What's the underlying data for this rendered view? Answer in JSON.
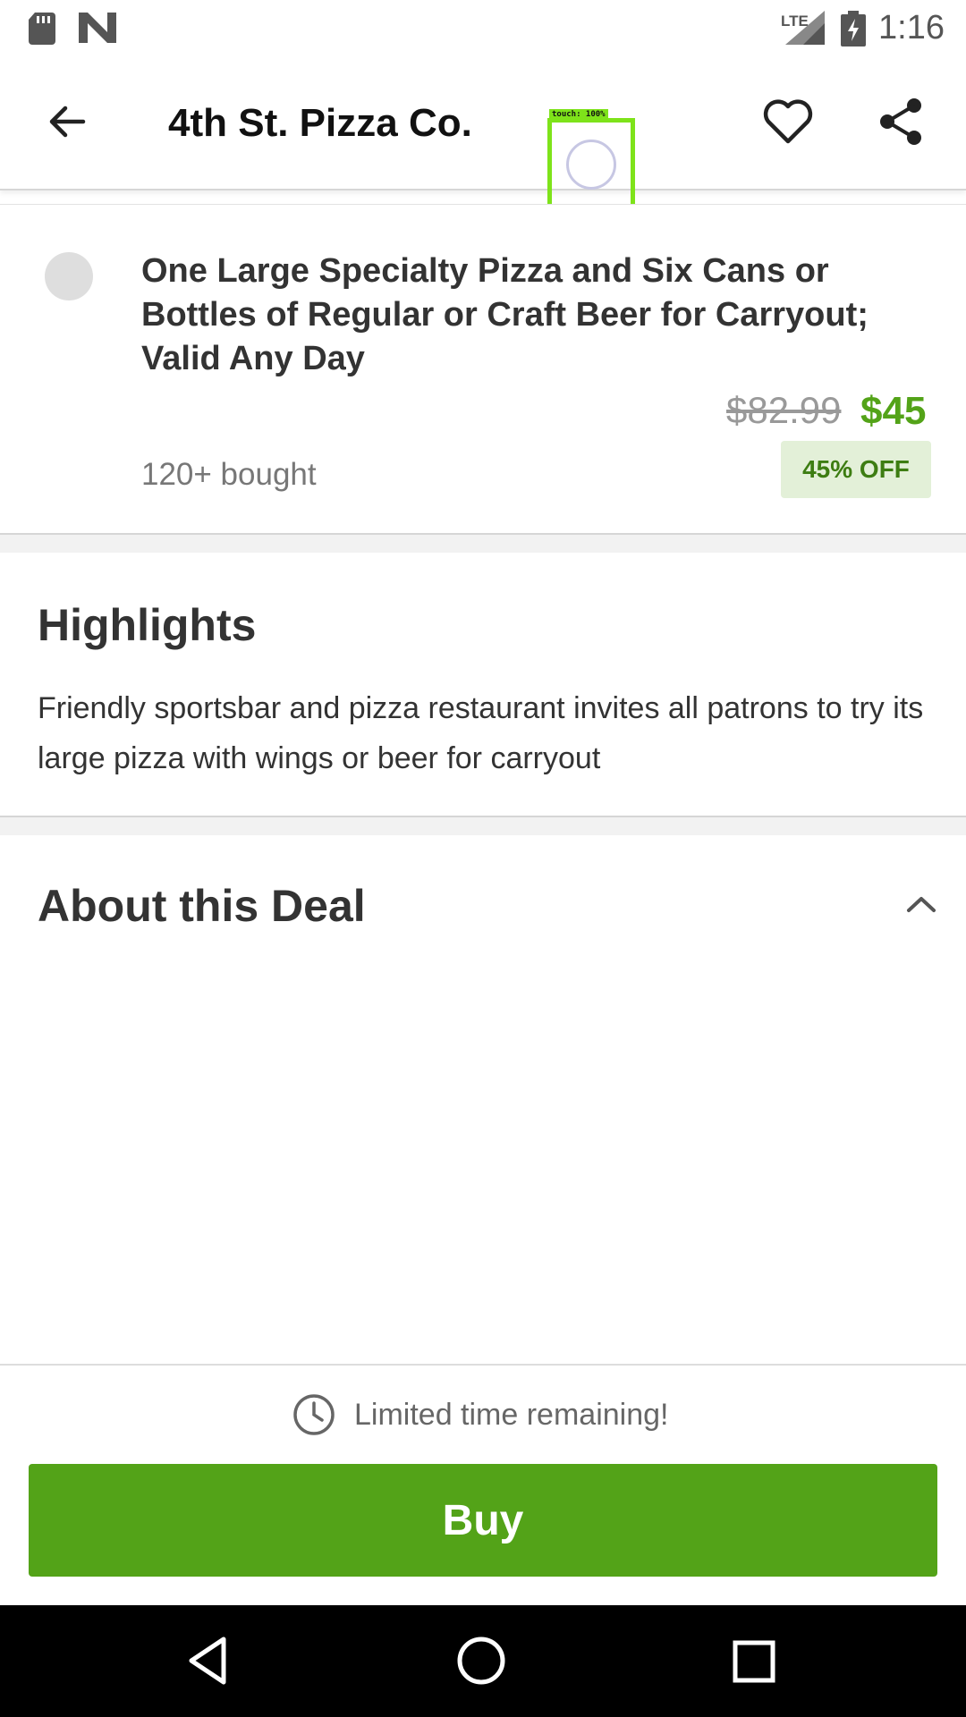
{
  "status_bar": {
    "network": "LTE",
    "time": "1:16",
    "icons": [
      "sd-card-icon",
      "n-logo-icon",
      "signal-icon",
      "battery-charging-icon"
    ]
  },
  "app_bar": {
    "title": "4th St. Pizza Co.",
    "icons": [
      "back-arrow-icon",
      "heart-icon",
      "share-icon"
    ]
  },
  "touch_overlay": {
    "label": "touch: 100%",
    "color": "#7ee31a"
  },
  "deal_option": {
    "title": "One Large Specialty Pizza and Six Cans or Bottles of Regular or Craft Beer for Carryout; Valid Any Day",
    "original_price": "$82.99",
    "sale_price": "$45",
    "bought": "120+ bought",
    "discount": "45% OFF",
    "selected": false
  },
  "highlights": {
    "title": "Highlights",
    "text": "Friendly sportsbar and pizza restaurant invites all patrons to try its large pizza with wings or beer for carryout"
  },
  "about": {
    "title": "About this Deal",
    "expanded": true
  },
  "buy_bar": {
    "limited_text": "Limited time remaining!",
    "buy_label": "Buy"
  },
  "colors": {
    "accent_green": "#53a318",
    "discount_bg": "#e3f0d8",
    "discount_text": "#3d7d12"
  },
  "nav_bar": {
    "icons": [
      "nav-back-icon",
      "nav-home-icon",
      "nav-recents-icon"
    ]
  }
}
